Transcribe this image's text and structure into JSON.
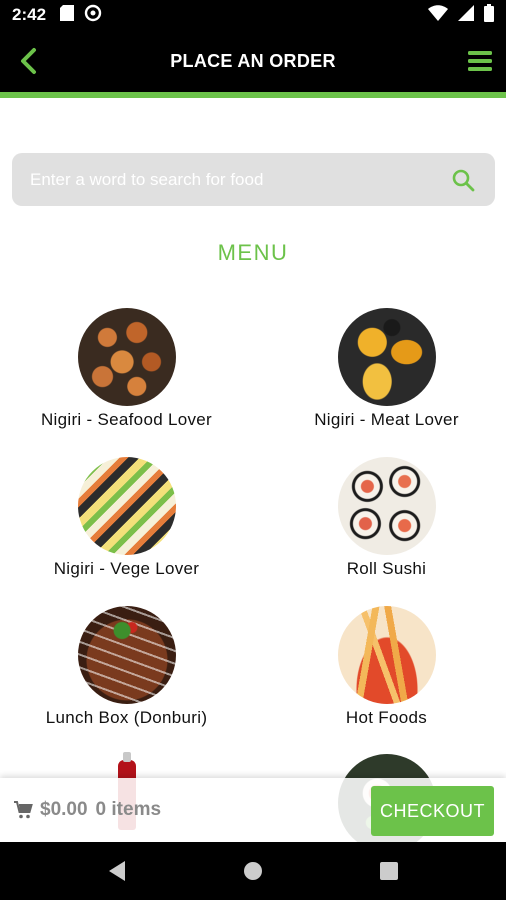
{
  "status_bar": {
    "time": "2:42",
    "icons": [
      "sd-card-icon",
      "data-saver-icon",
      "wifi-icon",
      "signal-icon",
      "battery-icon"
    ]
  },
  "app_bar": {
    "title": "PLACE AN ORDER",
    "back_icon": "chevron-left-icon",
    "menu_icon": "hamburger-menu-icon",
    "accent_color": "#6cc24a"
  },
  "search": {
    "placeholder": "Enter a word to search for food",
    "icon": "search-icon"
  },
  "menu": {
    "heading": "MENU",
    "items": [
      {
        "label": "Nigiri - Seafood Lover"
      },
      {
        "label": "Nigiri - Meat Lover"
      },
      {
        "label": "Nigiri - Vege Lover"
      },
      {
        "label": "Roll Sushi"
      },
      {
        "label": "Lunch Box (Donburi)"
      },
      {
        "label": "Hot Foods"
      }
    ]
  },
  "cart": {
    "icon": "cart-icon",
    "amount": "$0.00",
    "items": "0 items",
    "checkout_label": "CHECKOUT"
  },
  "nav_bar": {
    "icons": [
      "back-triangle-icon",
      "home-circle-icon",
      "recents-square-icon"
    ]
  }
}
